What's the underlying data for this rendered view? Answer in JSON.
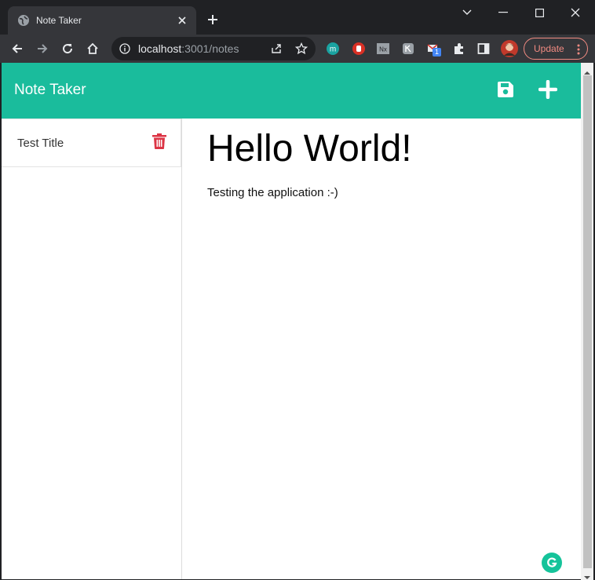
{
  "browser": {
    "tab_title": "Note Taker",
    "url_host": "localhost",
    "url_path": ":3001/notes",
    "update_label": "Update",
    "extension_badge": "1",
    "colors": {
      "frame": "#202124",
      "toolbar": "#35363a",
      "update_accent": "#f28b82"
    }
  },
  "app": {
    "brand": "Note Taker",
    "accent_color": "#1abc9c",
    "delete_color": "#dc3545",
    "notes": [
      {
        "title": "Test Title"
      }
    ],
    "active_note": {
      "title": "Hello World!",
      "text": "Testing the application :-)"
    }
  },
  "icons": {
    "save": "save-icon",
    "new_note": "plus-icon",
    "delete": "trash-icon",
    "grammarly": "grammarly-icon"
  }
}
